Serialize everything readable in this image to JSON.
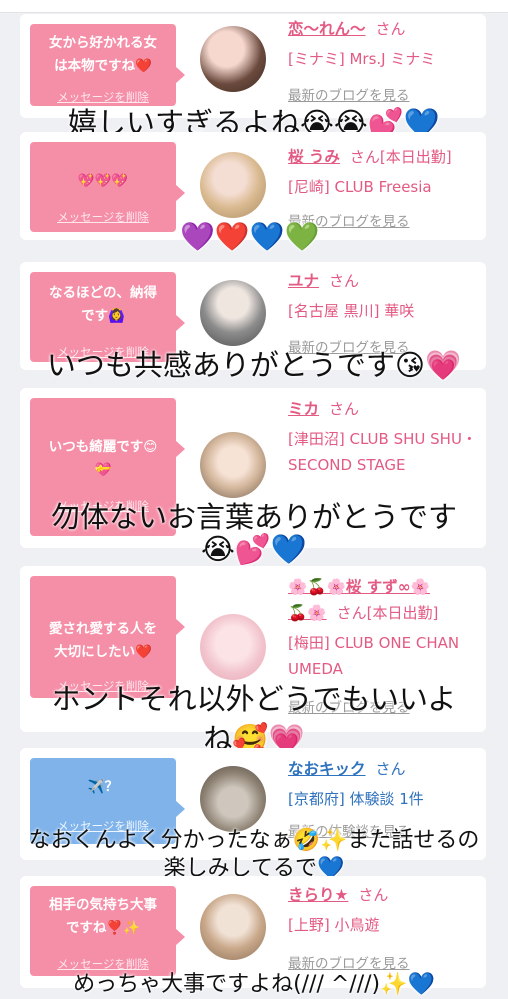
{
  "cards": [
    {
      "message": "女から好かれる女\nは本物ですね❤️",
      "delete_label": "メッセージを削除",
      "name": "恋〜れん〜",
      "honorific": "さん",
      "detail": "[ミナミ] Mrs.J ミナミ",
      "blog_label": "最新のブログを見る"
    },
    {
      "message": "💖💖💖",
      "delete_label": "メッセージを削除",
      "name": "桜 うみ",
      "honorific": "さん[本日出勤]",
      "detail": "[尼崎] CLUB Freesia",
      "blog_label": "最新のブログを見る"
    },
    {
      "message": "なるほどの、納得\nです🙆‍♀️",
      "delete_label": "メッセージを削除",
      "name": "ユナ",
      "honorific": "さん",
      "detail": "[名古屋 黒川] 華咲",
      "blog_label": "最新のブログを見る"
    },
    {
      "message": "いつも綺麗です😊\n💝",
      "delete_label": "メッセージを削除",
      "name": "ミカ",
      "honorific": "さん",
      "detail": "[津田沼] CLUB SHU SHU・SECOND STAGE",
      "blog_label": ""
    },
    {
      "message": "愛され愛する人を\n大切にしたい❤️",
      "delete_label": "メッセージを削除",
      "name": "🌸🍒🌸桜 すず∞🌸\n🍒🌸",
      "honorific": "さん[本日出勤]",
      "detail": "[梅田] CLUB ONE CHAN UMEDA",
      "blog_label": "最新のブログを見る"
    },
    {
      "message": "✈️？",
      "delete_label": "メッセージを削除",
      "name": "なおキック",
      "honorific": "さん",
      "detail": "[京都府] 体験談 1件",
      "blog_label": "最新の体験談を見る"
    },
    {
      "message": "相手の気持ち大事\nですね❣️✨",
      "delete_label": "メッセージを削除",
      "name": "きらり★",
      "honorific": "さん",
      "detail": "[上野] 小鳥遊",
      "blog_label": "最新のブログを見る"
    }
  ],
  "overlays": [
    "嬉しいすぎるよね😭😭💕💙",
    "💜❤️💙💚",
    "いつも共感ありがとうです😘💗",
    "勿体ないお言葉ありがとうです",
    "😭💕💙",
    "ホントそれ以外どうでもいいよ",
    "ね🥰💗",
    "なおくんよく分かったなぁ🤣✨また話せるの",
    "楽しみしてるで💙",
    "めっちゃ大事ですよね(/// ^///)✨💙"
  ],
  "colors": {
    "pink_bubble": "#f58ea7",
    "blue_bubble": "#7fb3ea",
    "pink_text": "#e35a83",
    "blue_text": "#2f72bd"
  }
}
